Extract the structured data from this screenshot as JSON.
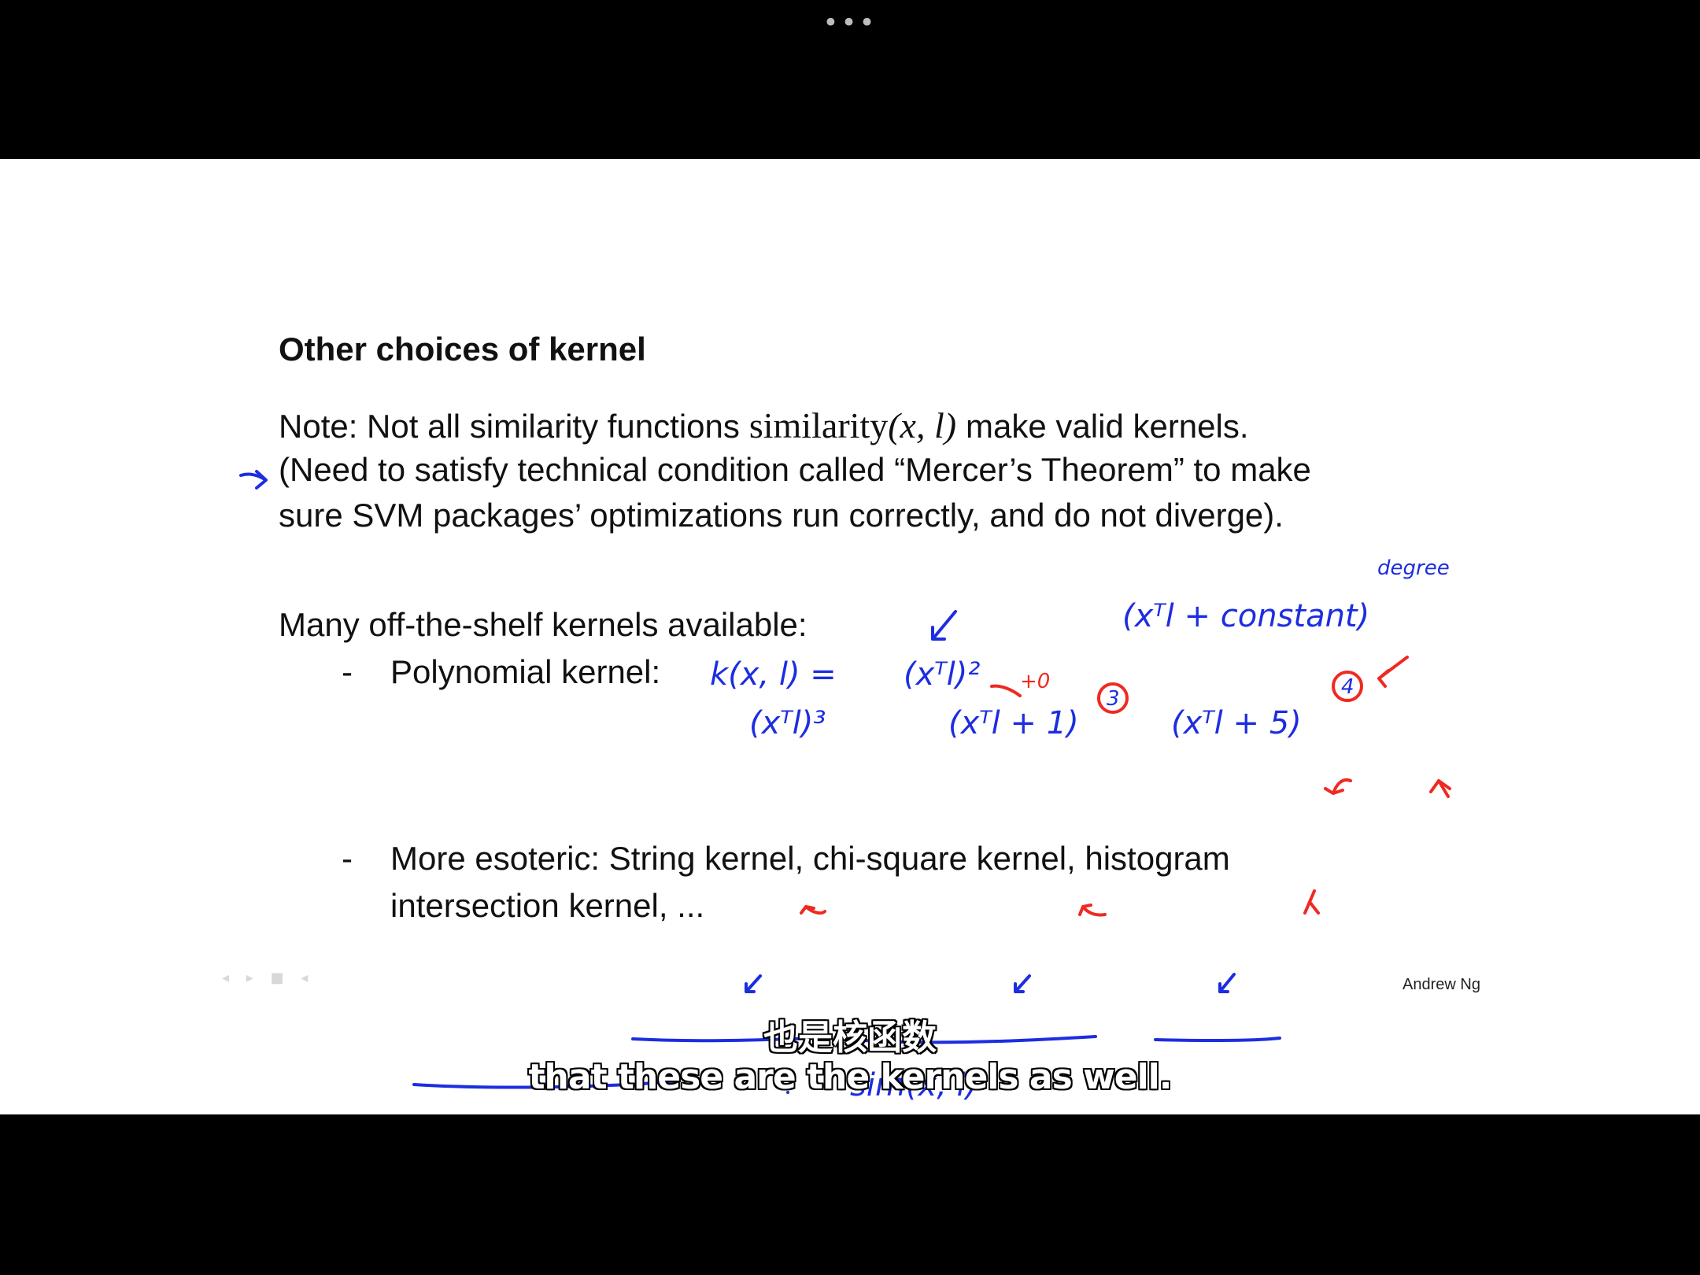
{
  "window": {
    "menu_dots": "•••"
  },
  "slide": {
    "title": "Other choices of kernel",
    "note_prefix": "Note: Not all similarity functions",
    "similarity_name": "similarity",
    "similarity_args": "(x, l)",
    "note_suffix": "make valid kernels.",
    "paren_line_1": "(Need to satisfy technical condition called “Mercer’s Theorem” to make",
    "paren_line_2": "sure SVM packages’ optimizations run correctly, and do not diverge).",
    "many": "Many off-the-shelf kernels available:",
    "bullet_dash": "-",
    "polynomial": "Polynomial kernel:",
    "esoteric_line_1": "More esoteric: String kernel, chi-square kernel, histogram",
    "esoteric_line_2": "intersection kernel, ...",
    "author": "Andrew Ng"
  },
  "handwriting": {
    "poly_formula": "k(x, l) =",
    "square": "(xᵀl)²",
    "square_note": "+0",
    "cube": "(xᵀl)³",
    "plus_one": "(xᵀl + 1)",
    "circle_three": "3",
    "plus_five": "(xᵀl + 5)",
    "circle_four": "4",
    "general": "(xᵀl + constant)",
    "degree": "degree",
    "sim": "sim(x, l)"
  },
  "subtitles": {
    "chinese": "也是核函数",
    "english": "that these are the kernels as well."
  },
  "colors": {
    "ink_blue": "#1d2de0",
    "ink_red": "#ef2a22"
  }
}
